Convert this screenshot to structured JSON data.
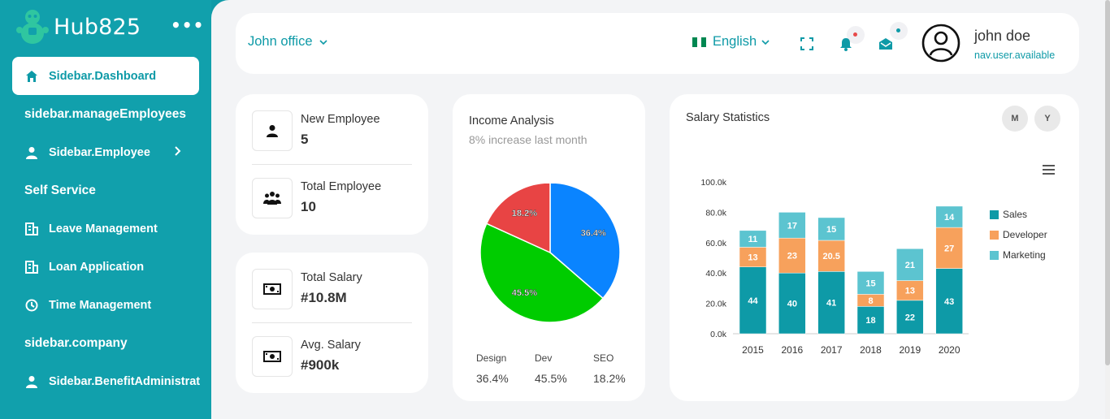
{
  "app": {
    "name": "Hub825",
    "menu_label": "•••"
  },
  "sidebar": {
    "items": [
      {
        "label": "Sidebar.Dashboard",
        "icon": "home-icon",
        "active": true
      },
      {
        "label": "sidebar.manageEmployees",
        "type": "section"
      },
      {
        "label": "Sidebar.Employee",
        "icon": "user-icon",
        "chevron": true
      },
      {
        "label": "Self Service",
        "type": "section"
      },
      {
        "label": "Leave Management",
        "icon": "building-icon"
      },
      {
        "label": "Loan Application",
        "icon": "building-icon"
      },
      {
        "label": "Time Management",
        "icon": "clock-icon"
      },
      {
        "label": "sidebar.company",
        "type": "section"
      },
      {
        "label": "Sidebar.BenefitAdministrat",
        "icon": "user-icon"
      }
    ]
  },
  "topbar": {
    "office": "John office",
    "language": "English",
    "user_name": "john doe",
    "user_status": "nav.user.available",
    "colors": {
      "accent": "#0e9aa7",
      "notif_dot": "#e84a4a",
      "mail_dot": "#0e9aa7"
    }
  },
  "stats_top": [
    {
      "label": "New Employee",
      "value": "5",
      "icon": "person-icon"
    },
    {
      "label": "Total Employee",
      "value": "10",
      "icon": "group-icon"
    }
  ],
  "stats_bottom": [
    {
      "label": "Total Salary",
      "value": "#10.8M",
      "icon": "banknote-icon"
    },
    {
      "label": "Avg. Salary",
      "value": "#900k",
      "icon": "banknote-icon"
    }
  ],
  "income": {
    "title": "Income Analysis",
    "subtitle": "8% increase last month",
    "legend": [
      {
        "label": "Design",
        "value": "36.4%"
      },
      {
        "label": "Dev",
        "value": "45.5%"
      },
      {
        "label": "SEO",
        "value": "18.2%"
      }
    ]
  },
  "salary": {
    "title": "Salary Statistics",
    "toggles": [
      "M",
      "Y"
    ]
  },
  "chart_data": [
    {
      "type": "pie",
      "categories": [
        "Design",
        "Dev",
        "SEO"
      ],
      "values": [
        36.4,
        45.5,
        18.2
      ],
      "labels": [
        "36.4%",
        "45.5%",
        "18.2%"
      ],
      "colors": [
        "#0a84ff",
        "#00cc00",
        "#e84444"
      ]
    },
    {
      "type": "bar",
      "stacked": true,
      "categories": [
        "2015",
        "2016",
        "2017",
        "2018",
        "2019",
        "2020"
      ],
      "series": [
        {
          "name": "Sales",
          "values": [
            44,
            40,
            41,
            18,
            22,
            43
          ],
          "labels": [
            "44",
            "40",
            "41",
            "18",
            "22",
            "43"
          ],
          "color": "#0e9aa7"
        },
        {
          "name": "Developer",
          "values": [
            13,
            23,
            20.5,
            8,
            13,
            27
          ],
          "labels": [
            "13",
            "23",
            "20.5",
            "8",
            "13",
            "27"
          ],
          "color": "#f7a15c"
        },
        {
          "name": "Marketing",
          "values": [
            11,
            17,
            15,
            15,
            21,
            14
          ],
          "labels": [
            "11",
            "17",
            "15",
            "15",
            "21",
            "14"
          ],
          "color": "#5cc4d0"
        }
      ],
      "yticks": [
        "0.0k",
        "20.0k",
        "40.0k",
        "60.0k",
        "80.0k",
        "100.0k"
      ],
      "ylim": [
        0,
        100
      ],
      "legend": "right",
      "menu_icon": "hamburger-icon"
    }
  ]
}
